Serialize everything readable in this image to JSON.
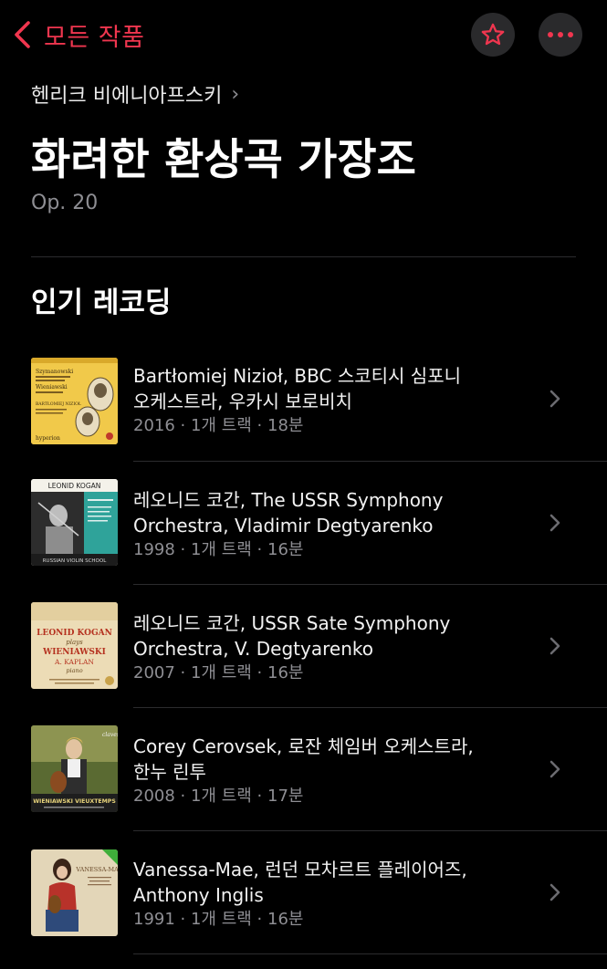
{
  "nav": {
    "back_label": "모든 작품",
    "accent": "#f0364f"
  },
  "header": {
    "composer": "헨리크 비에니아프스키",
    "title": "화려한 환상곡 가장조",
    "opus": "Op. 20"
  },
  "section": {
    "title": "인기 레코딩"
  },
  "recordings": [
    {
      "artists_line1": "Bartłomiej Nizioł, BBC 스코티시 심포니",
      "artists_line2": "오케스트라, 우카시 보로비치",
      "meta": "2016 · 1개 트랙 · 18분",
      "cover": {
        "top": "Szymanowski",
        "mid": "Wieniawski",
        "name": "BARTŁOMIEJ NIZIOŁ",
        "label": "hyperion"
      }
    },
    {
      "artists_line1": "레오니드 코간, The USSR Symphony",
      "artists_line2": "Orchestra, Vladimir Degtyarenko",
      "meta": "1998 · 1개 트랙 · 16분",
      "cover": {
        "top": "LEONID KOGAN",
        "bottom": "RUSSIAN VIOLIN SCHOOL"
      }
    },
    {
      "artists_line1": "레오니드 코간, USSR Sate Symphony",
      "artists_line2": "Orchestra, V. Degtyarenko",
      "meta": "2007 · 1개 트랙 · 16분",
      "cover": {
        "line1": "LEONID KOGAN",
        "line2": "plays",
        "line3": "WIENIAWSKI",
        "line4": "A. KAPLAN",
        "line5": "piano"
      }
    },
    {
      "artists_line1": "Corey Cerovsek, 로잔 체임버 오케스트라,",
      "artists_line2": "한누 린투",
      "meta": "2008 · 1개 트랙 · 17분",
      "cover": {
        "label": "claves",
        "bottom": "WIENIAWSKI VIEUXTEMPS"
      }
    },
    {
      "artists_line1": "Vanessa-Mae, 런던 모차르트 플레이어즈,",
      "artists_line2": "Anthony Inglis",
      "meta": "1991 · 1개 트랙 · 16분",
      "cover": {
        "title": "VANESSA-MAE"
      }
    }
  ]
}
